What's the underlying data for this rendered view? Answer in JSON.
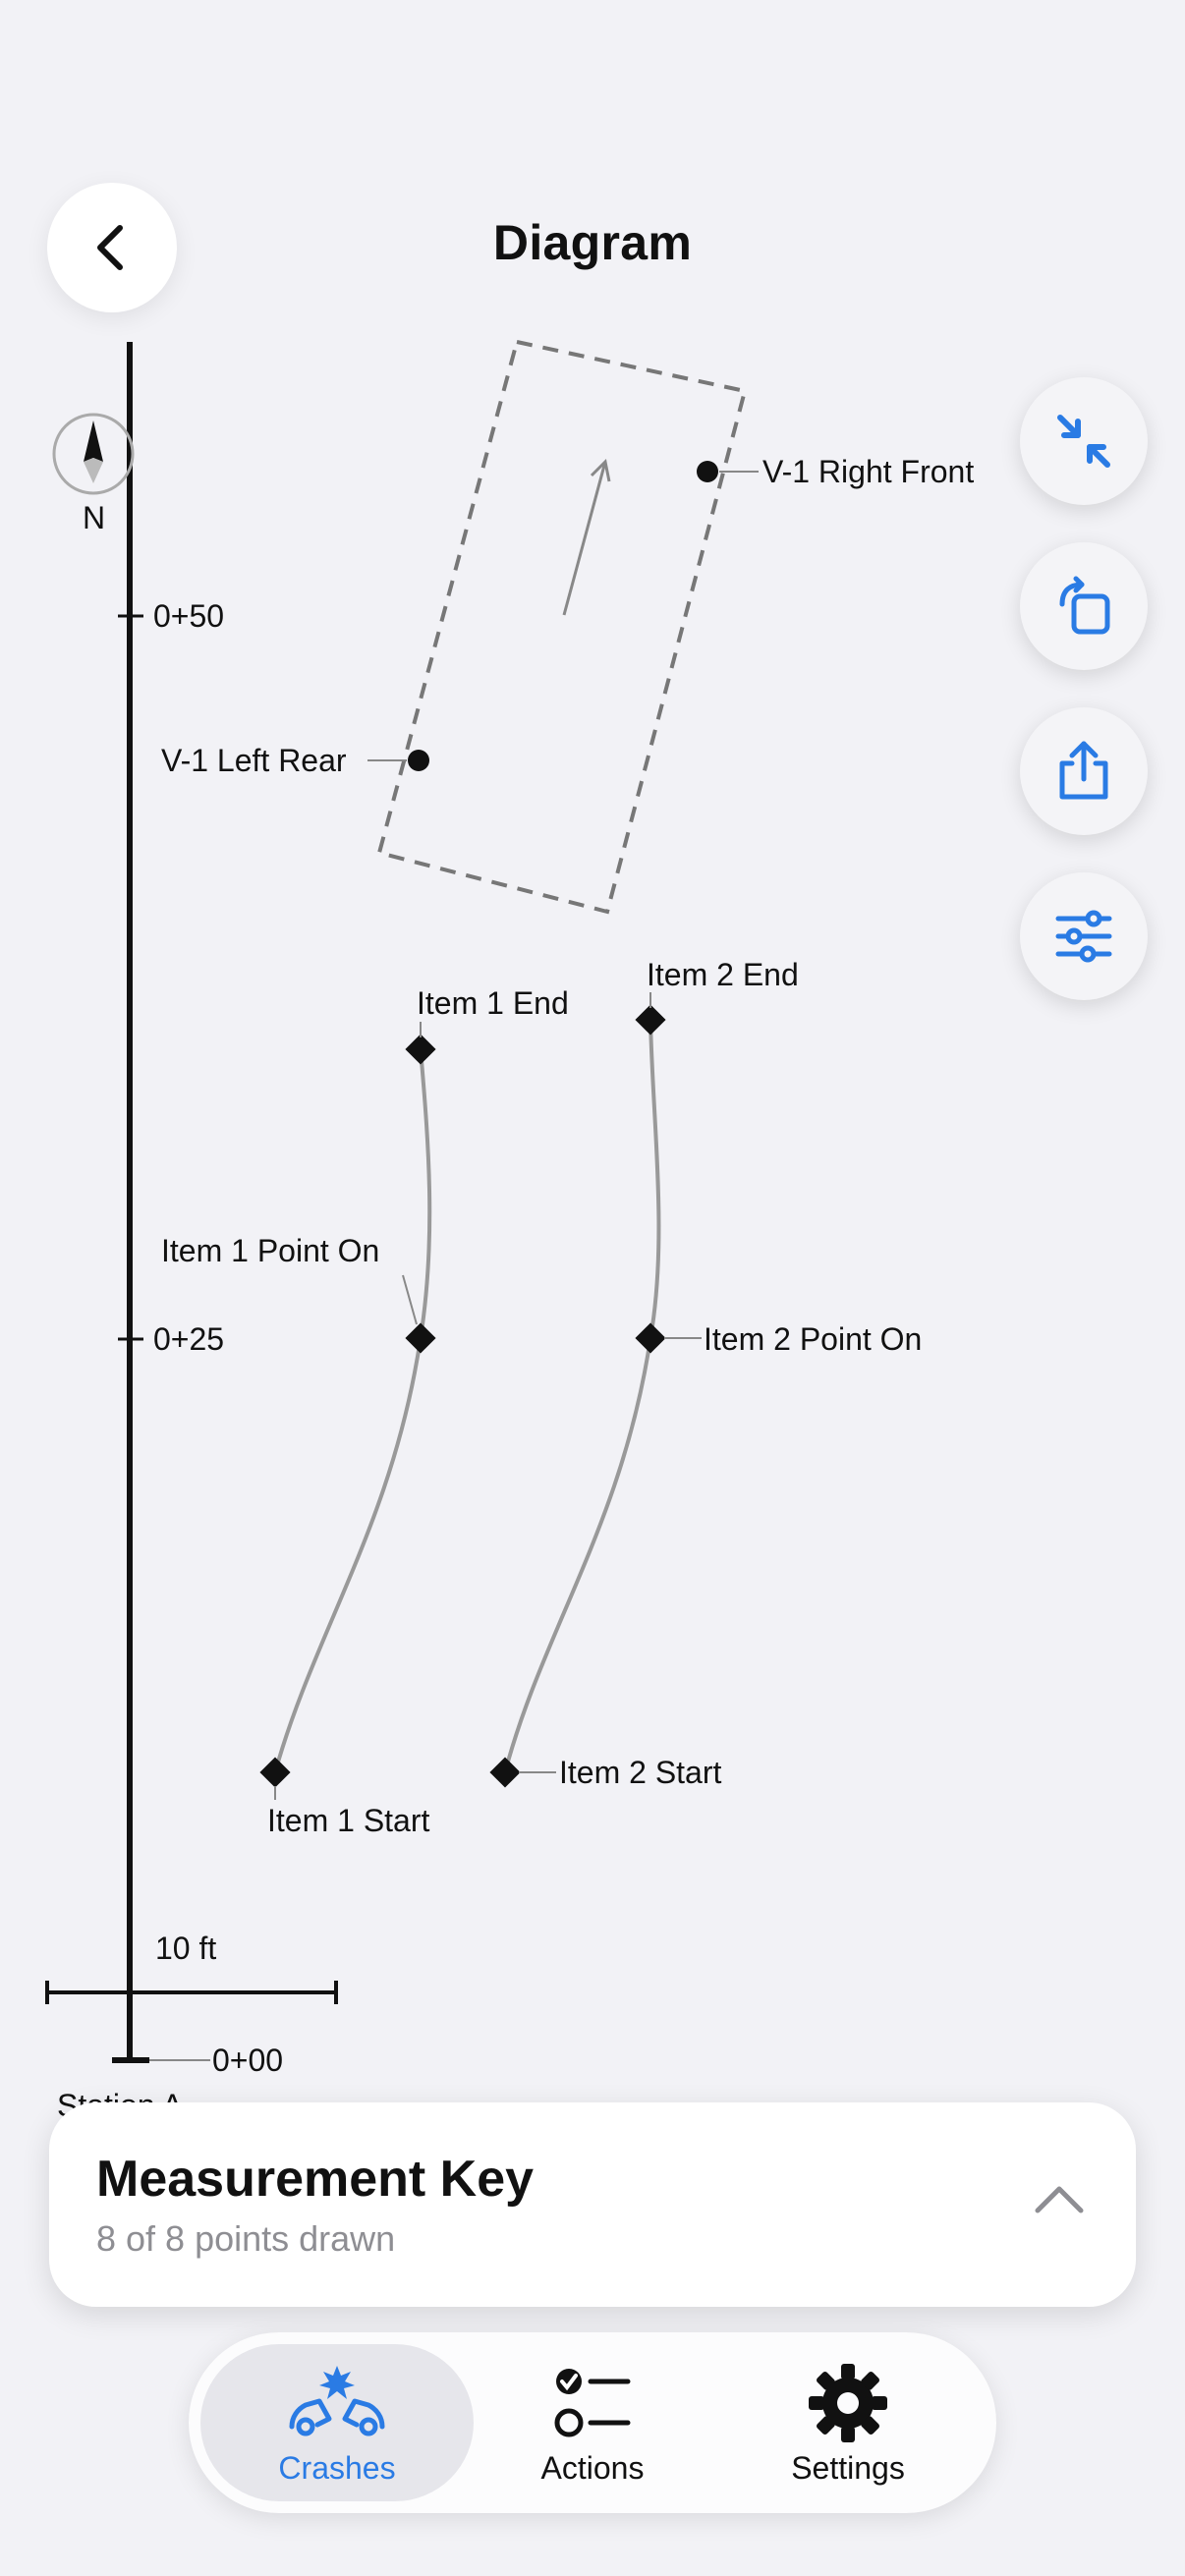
{
  "header": {
    "title": "Diagram"
  },
  "diagram": {
    "north_label": "N",
    "stations": [
      "0+50",
      "0+25",
      "0+00"
    ],
    "station_partial": "Station A",
    "scale_label": "10 ft",
    "vehicle_points": [
      "V-1 Right Front",
      "V-1 Left Rear"
    ],
    "item_points": [
      "Item 1 End",
      "Item 2 End",
      "Item 1 Point On",
      "Item 2 Point On",
      "Item 1 Start",
      "Item 2 Start"
    ]
  },
  "measurement_key": {
    "title": "Measurement Key",
    "subtitle": "8 of 8 points drawn"
  },
  "tabs": [
    {
      "label": "Crashes",
      "icon": "crash-icon",
      "active": true
    },
    {
      "label": "Actions",
      "icon": "checklist-icon",
      "active": false
    },
    {
      "label": "Settings",
      "icon": "gear-icon",
      "active": false
    }
  ],
  "colors": {
    "accent": "#2a7be4",
    "background": "#f2f2f6"
  }
}
